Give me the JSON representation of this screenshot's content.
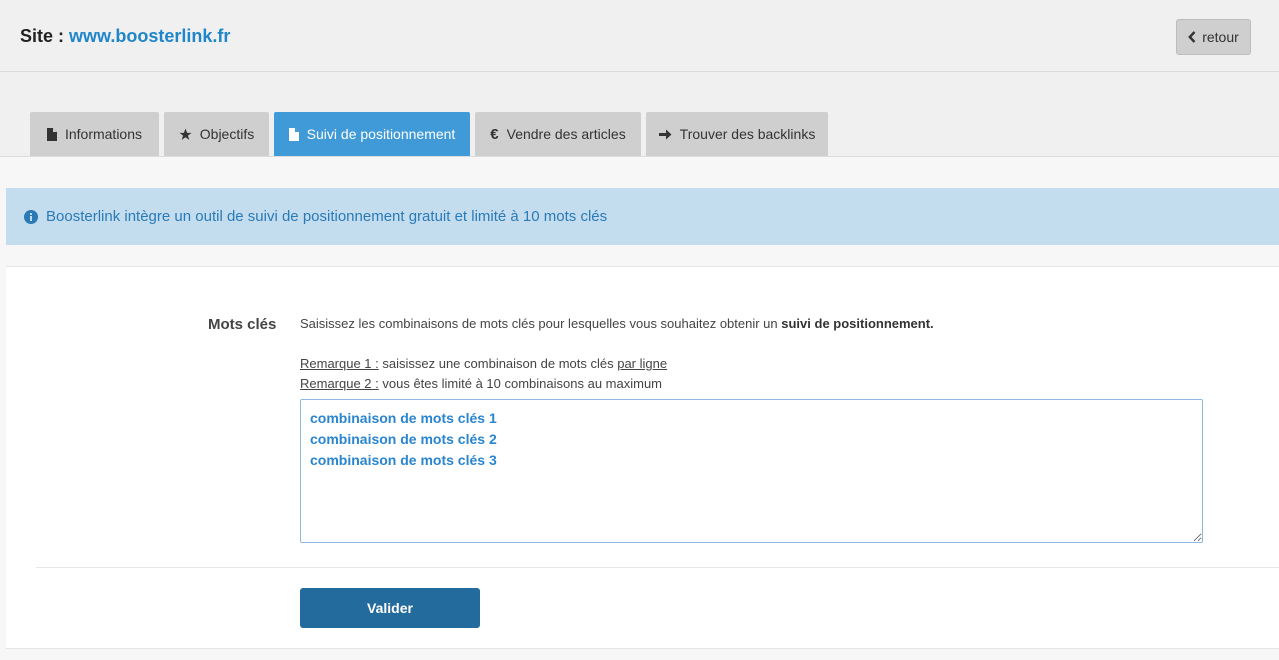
{
  "header": {
    "site_label": "Site : ",
    "site_url": "www.boosterlink.fr",
    "back_label": "retour"
  },
  "tabs": [
    {
      "label": "Informations",
      "icon": "file-icon",
      "active": false
    },
    {
      "label": "Objectifs",
      "icon": "star-icon",
      "active": false
    },
    {
      "label": "Suivi de positionnement",
      "icon": "file-icon",
      "active": true
    },
    {
      "label": "Vendre des articles",
      "icon": "euro-icon",
      "active": false
    },
    {
      "label": "Trouver des backlinks",
      "icon": "arrow-right-icon",
      "active": false
    }
  ],
  "info_banner": {
    "text": "Boosterlink intègre un outil de suivi de positionnement gratuit et limité à 10 mots clés",
    "icon": "info-circle-icon"
  },
  "form": {
    "label": "Mots clés",
    "instructions_prefix": "Saisissez les combinaisons de mots clés pour lesquelles vous souhaitez obtenir un ",
    "instructions_bold": "suivi de positionnement.",
    "note1_title": "Remarque 1 :",
    "note1_text": " saisissez une combinaison de mots clés ",
    "note1_link": "par ligne",
    "note2_title": "Remarque 2 :",
    "note2_text": " vous êtes limité à 10 combinaisons au maximum",
    "textarea_value": "combinaison de mots clés 1\ncombinaison de mots clés 2\ncombinaison de mots clés 3",
    "submit_label": "Valider"
  },
  "colors": {
    "link": "#1f86c9",
    "active_tab": "#3f9ad7",
    "banner_bg": "#c3ddef",
    "banner_text": "#2a7ab8",
    "submit_bg": "#236a9d"
  }
}
